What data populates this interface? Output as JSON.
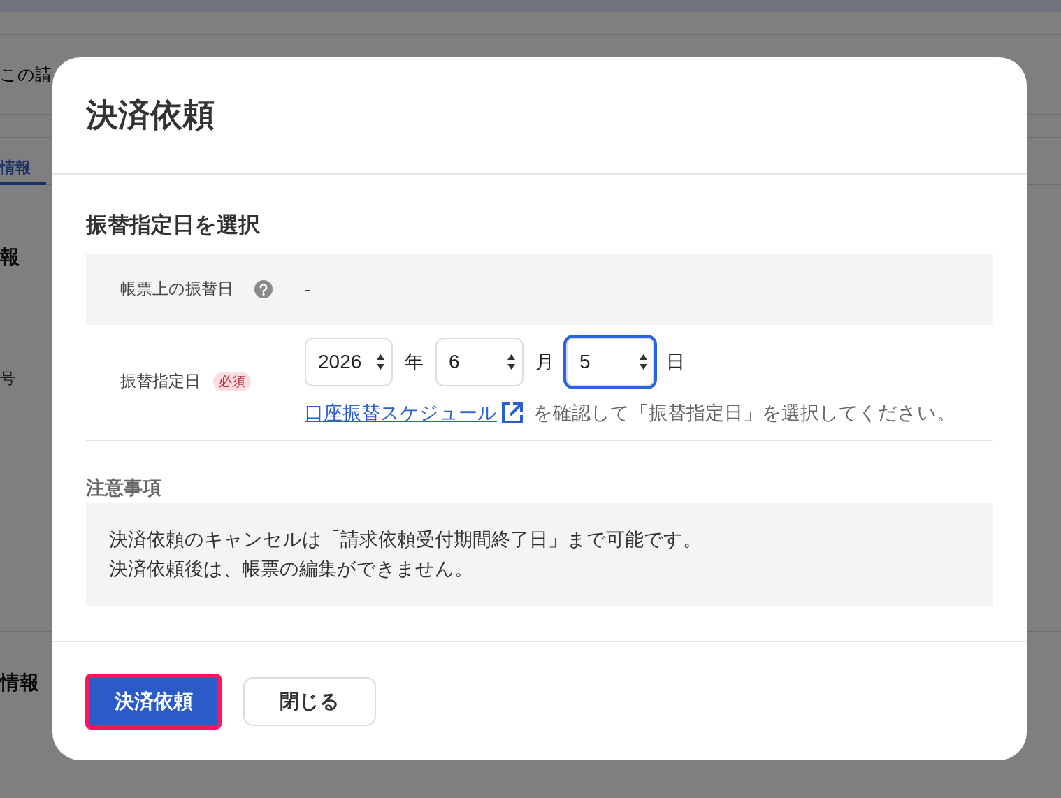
{
  "background_page": {
    "page_title": "この請",
    "tabs": [
      {
        "label": "情報",
        "selected": true
      }
    ],
    "sections": [
      {
        "heading": "報",
        "field_label": "号"
      },
      {
        "heading": "情報"
      }
    ]
  },
  "dialog": {
    "title": "決済依頼",
    "section_title": "振替指定日を選択",
    "invoice_date": {
      "label": "帳票上の振替日",
      "value": "-"
    },
    "transfer_date": {
      "label": "振替指定日",
      "badge": "必須",
      "selects": [
        {
          "value": "2026",
          "unit": "年",
          "focused": false
        },
        {
          "value": "6",
          "unit": "月",
          "focused": false
        },
        {
          "value": "5",
          "unit": "日",
          "focused": true
        }
      ],
      "link": "口座振替スケジュール",
      "hint": "を確認して「振替指定日」を選択してください。"
    },
    "notes": {
      "title": "注意事項",
      "lines": [
        "決済依頼のキャンセルは「請求依頼受付期間終了日」まで可能です。",
        "決済依頼後は、帳票の編集ができません。"
      ]
    },
    "buttons": [
      {
        "label": "決済依頼",
        "kind": "primary",
        "focused": true
      },
      {
        "label": "閉じる",
        "kind": "secondary",
        "focused": false
      }
    ]
  }
}
